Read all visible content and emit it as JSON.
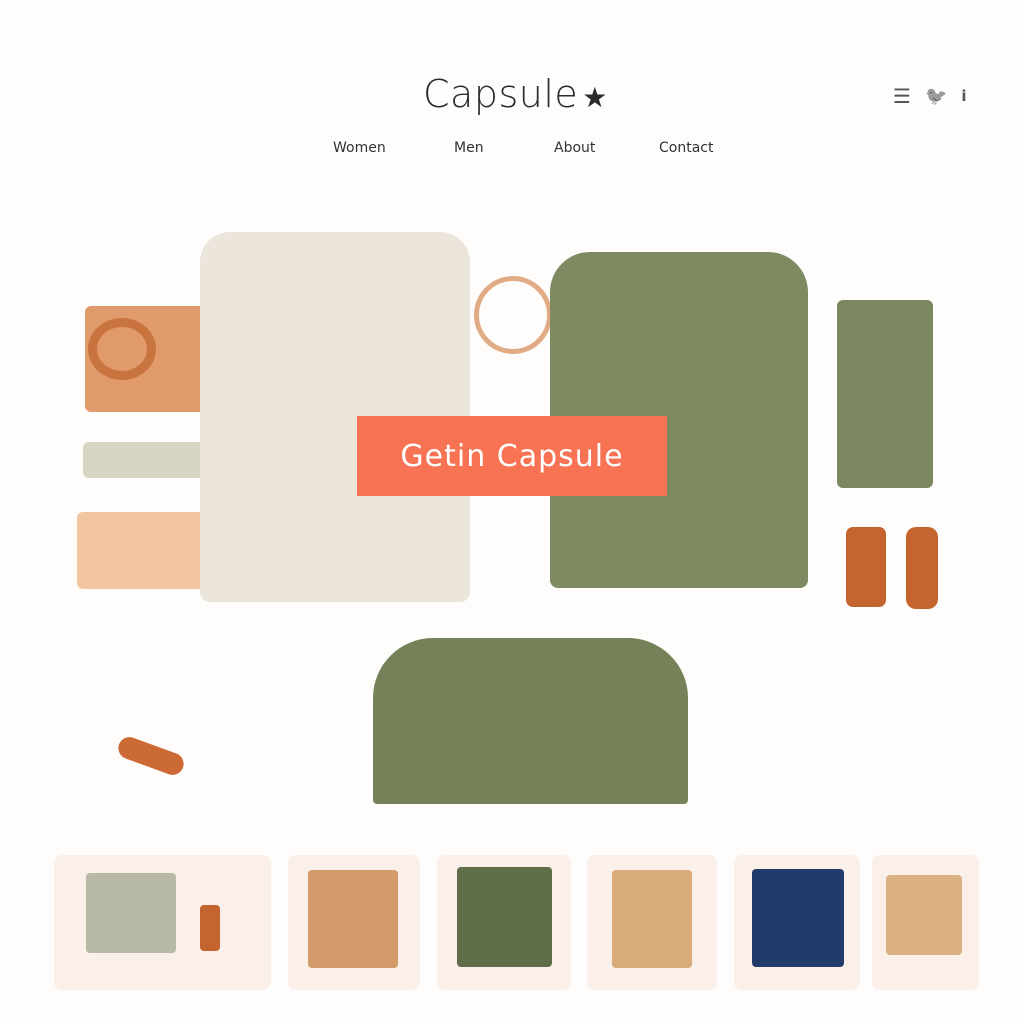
{
  "header": {
    "logo": "Capsule",
    "logo_icon": "star-icon",
    "icons": [
      "menu-icon",
      "twitter-icon",
      "info-icon"
    ],
    "icon_glyphs": [
      "☰",
      "🐦",
      "i"
    ]
  },
  "nav": {
    "items": [
      "Women",
      "Men",
      "About",
      "Contact"
    ]
  },
  "hero": {
    "cta_label": "Getin Capsule",
    "cta_color": "#f87254"
  },
  "products": {
    "count": 6
  }
}
